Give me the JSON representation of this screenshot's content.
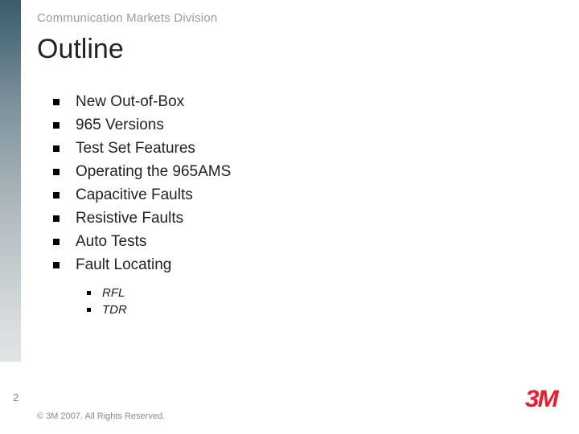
{
  "header": {
    "division": "Communication Markets Division",
    "title": "Outline"
  },
  "bullets": [
    "New Out-of-Box",
    "965 Versions",
    "Test Set Features",
    "Operating the 965AMS",
    "Capacitive Faults",
    "Resistive Faults",
    "Auto Tests",
    "Fault Locating"
  ],
  "sub_bullets": [
    "RFL",
    "TDR"
  ],
  "footer": {
    "page": "2",
    "copyright": "© 3M 2007.  All Rights Reserved.",
    "logo_text": "3M"
  }
}
